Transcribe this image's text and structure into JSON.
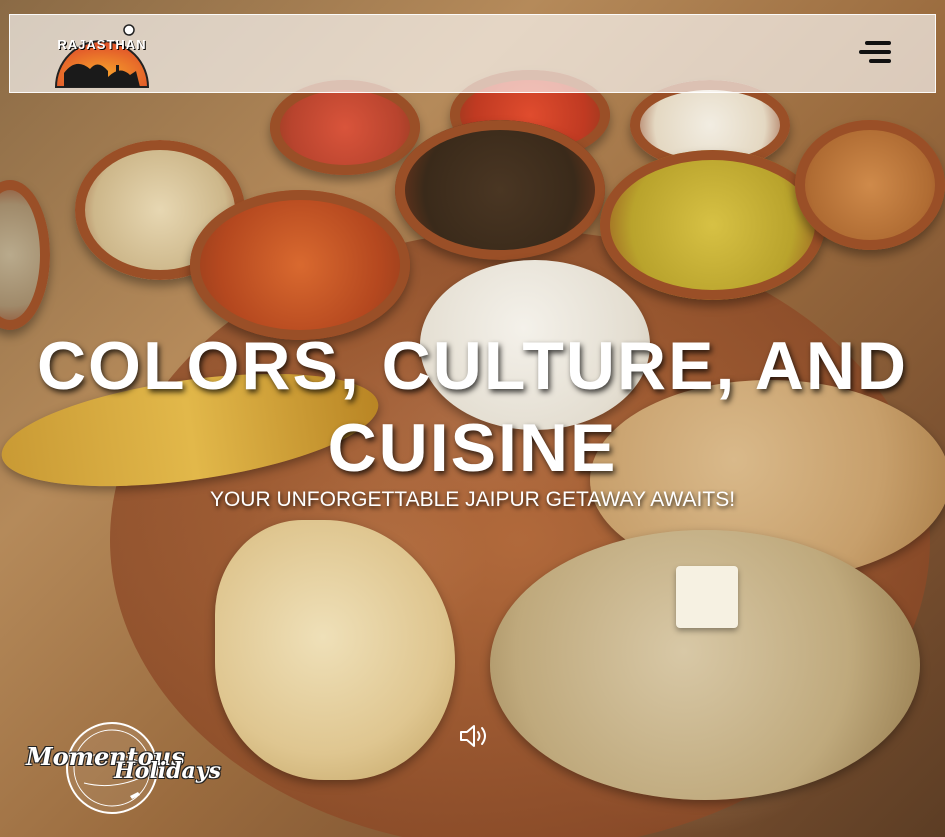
{
  "navbar": {
    "logo_text": "RAJASTHAN",
    "menu_icon": "hamburger-menu-icon"
  },
  "hero": {
    "headline": "COLORS, CULTURE, AND CUISINE",
    "subheadline": "YOUR UNFORGETTABLE JAIPUR GETAWAY AWAITS!",
    "sound_icon": "volume-icon"
  },
  "brand": {
    "line1": "Momentous",
    "line2": "Holidays"
  }
}
